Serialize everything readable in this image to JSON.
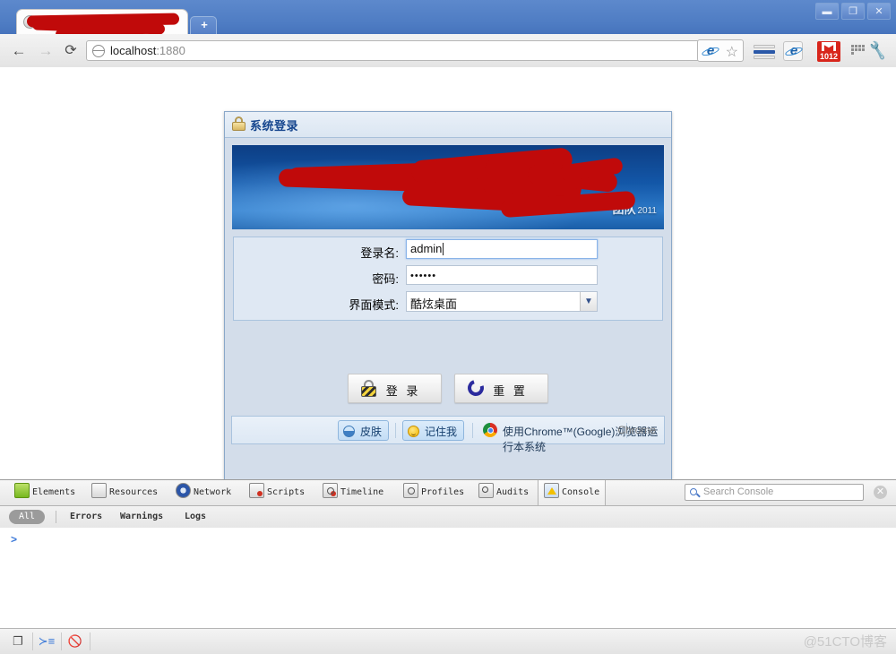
{
  "window": {
    "controls": [
      {
        "name": "minimize",
        "glyph": "▬"
      },
      {
        "name": "restore",
        "glyph": "❐"
      },
      {
        "name": "close",
        "glyph": "✕"
      }
    ]
  },
  "tab": {
    "title": "",
    "favicon": "globe-icon",
    "new_tab_label": "+"
  },
  "toolbar": {
    "back": "←",
    "forward": "→",
    "reload": "⟳",
    "url_host": "localhost",
    "url_port": ":1880",
    "globe_icon": "page-globe-icon",
    "bookmark_star": "☆",
    "gmail_count": "1012",
    "wrench": "🔧"
  },
  "panel": {
    "title": "系统登录",
    "lock_icon": "padlock-icon",
    "banner": {
      "team_text": "团队",
      "year": "2011"
    },
    "form": {
      "fields": [
        {
          "label": "登录名:",
          "value": "admin",
          "type": "text",
          "focused": true
        },
        {
          "label": "密码:",
          "value": "••••••",
          "type": "password",
          "focused": false
        },
        {
          "label": "界面模式:",
          "value": "酷炫桌面",
          "type": "select",
          "focused": false
        }
      ]
    },
    "buttons": [
      {
        "label": "登 录",
        "icon": "lock-icon"
      },
      {
        "label": "重 置",
        "icon": "refresh-icon"
      }
    ],
    "footer": {
      "skin_label": "皮肤",
      "remember_label": "记住我",
      "message": "使用Chrome™(Google)浏览器运行本系统",
      "browser_label": "Chrome"
    }
  },
  "devtools": {
    "tabs": [
      {
        "label": "Elements",
        "icon": "elements-icon",
        "active": false
      },
      {
        "label": "Resources",
        "icon": "resources-icon",
        "active": false
      },
      {
        "label": "Network",
        "icon": "network-icon",
        "active": false
      },
      {
        "label": "Scripts",
        "icon": "scripts-icon",
        "active": false
      },
      {
        "label": "Timeline",
        "icon": "timeline-icon",
        "active": false
      },
      {
        "label": "Profiles",
        "icon": "profiles-icon",
        "active": false
      },
      {
        "label": "Audits",
        "icon": "audits-icon",
        "active": false
      },
      {
        "label": "Console",
        "icon": "console-icon",
        "active": true
      }
    ],
    "search": {
      "placeholder": "Search Console",
      "search_icon": "search-icon",
      "close_icon": "close-icon"
    },
    "filters": {
      "all": "All",
      "items": [
        "Errors",
        "Warnings",
        "Logs"
      ]
    },
    "console_prompt": ">",
    "statusbar": {
      "dock_icon": "dock-window-icon",
      "prompt_icon": "console-prompt-icon",
      "clear_icon": "clear-console-icon"
    }
  },
  "watermark": "@51CTO博客"
}
